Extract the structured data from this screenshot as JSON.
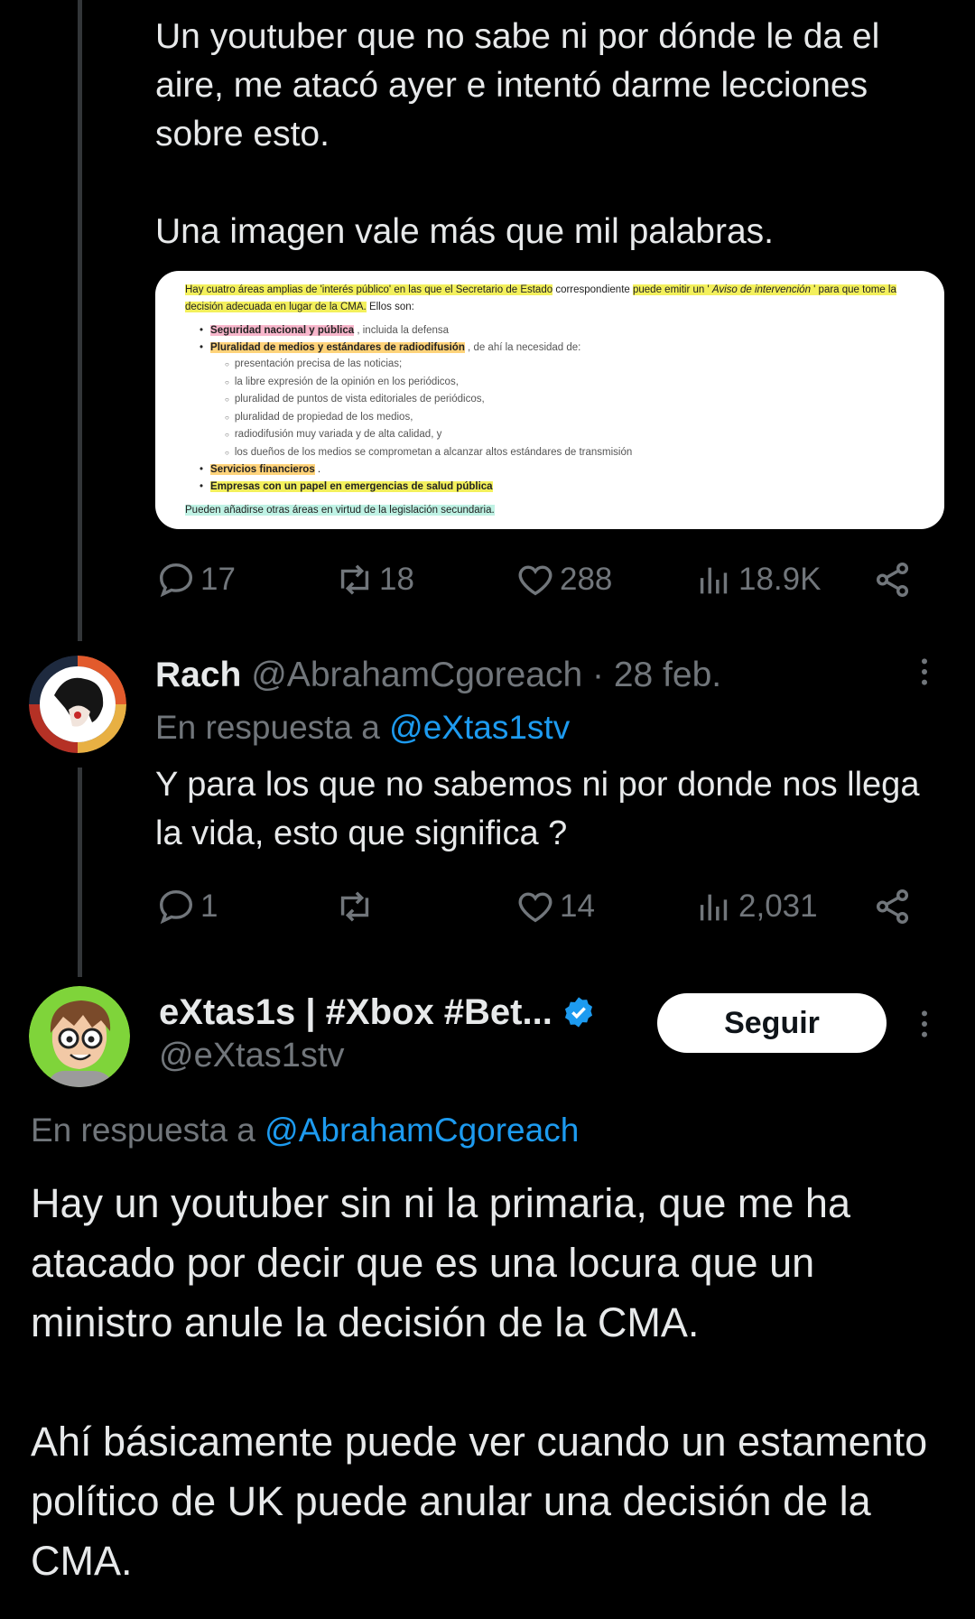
{
  "tweet1": {
    "text": "Un youtuber que no sabe ni por dónde le da el aire, me atacó ayer e intentó darme lecciones sobre esto.\n\nUna imagen vale más que mil palabras.",
    "embed": {
      "intro_a": "Hay cuatro áreas amplias de 'interés público' en las que el Secretario de Estado",
      "intro_b": " correspondiente ",
      "intro_c": "puede emitir un ' ",
      "intro_d": "Aviso de intervención",
      "intro_e": " ' para que tome la decisión adecuada en lugar de la CMA.",
      "intro_f": " Ellos son:",
      "b1": "Seguridad nacional y pública",
      "b1_rest": " , incluida la defensa",
      "b2": "Pluralidad de medios y estándares de radiodifusión",
      "b2_rest": " , de ahí la necesidad de:",
      "sub": [
        "presentación precisa de las noticias;",
        "la libre expresión de la opinión en los periódicos,",
        "pluralidad de puntos de vista editoriales de periódicos,",
        "pluralidad de propiedad de los medios,",
        "radiodifusión muy variada y de alta calidad, y",
        "los dueños de los medios se comprometan a alcanzar altos estándares de transmisión"
      ],
      "b3": "Servicios financieros",
      "b3_rest": " .",
      "b4": "Empresas con un papel en emergencias de salud pública",
      "footer": "Pueden añadirse otras áreas en virtud de la legislación secundaria."
    },
    "stats": {
      "replies": "17",
      "retweets": "18",
      "likes": "288",
      "views": "18.9K"
    }
  },
  "tweet2": {
    "name": "Rach",
    "handle": "@AbrahamCgoreach",
    "sep": " · ",
    "date": "28 feb.",
    "reply_prefix": "En respuesta a ",
    "reply_to": "@eXtas1stv",
    "text": "Y para los que no sabemos ni por donde nos llega la vida, esto que significa ?",
    "stats": {
      "replies": "1",
      "retweets": "",
      "likes": "14",
      "views": "2,031"
    }
  },
  "tweet3": {
    "name": "eXtas1s | #Xbox #Bet...",
    "handle": "@eXtas1stv",
    "follow_label": "Seguir",
    "reply_prefix": "En respuesta a ",
    "reply_to": "@AbrahamCgoreach",
    "text": "Hay un youtuber sin ni la primaria, que me ha atacado por decir que es una locura que un ministro anule la decisión de la CMA.\n\nAhí básicamente puede ver cuando un estamento político de UK puede anular una decisión de la CMA."
  },
  "colors": {
    "background": "#000000",
    "text": "#e7e9ea",
    "muted": "#71767b",
    "link": "#1d9bf0",
    "verified": "#1d9bf0"
  },
  "icons": [
    "reply-icon",
    "retweet-icon",
    "like-icon",
    "views-icon",
    "share-icon",
    "more-icon",
    "verified-badge-icon"
  ]
}
